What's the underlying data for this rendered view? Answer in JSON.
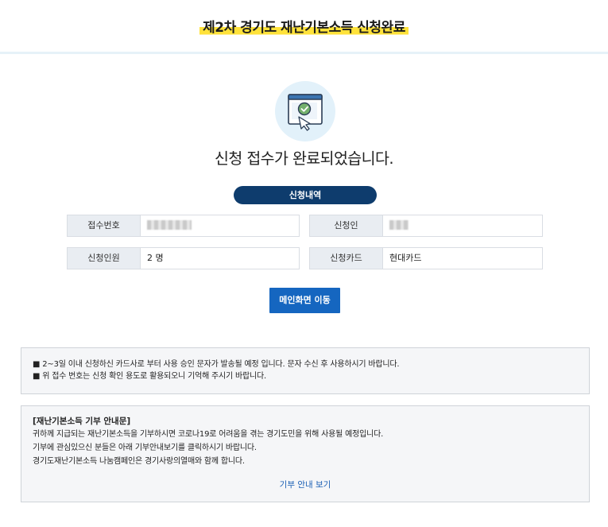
{
  "header": {
    "title": "제2차 경기도 재난기본소득 신청완료"
  },
  "status": {
    "message": "신청 접수가 완료되었습니다."
  },
  "section": {
    "title": "신청내역"
  },
  "details": {
    "receipt_label": "접수번호",
    "applicant_label": "신청인",
    "members_label": "신청인원",
    "members_value": "2 명",
    "card_label": "신청카드",
    "card_value": "현대카드"
  },
  "buttons": {
    "main": "메인화면 이동"
  },
  "notice": {
    "line1": "■ 2~3일 이내 신청하신 카드사로 부터 사용 승인 문자가 발송될 예정 입니다. 문자 수신 후 사용하시기 바랍니다.",
    "line2": "■ 위 접수 번호는 신청 확인 용도로 활용되오니 기억해 주시기 바랍니다."
  },
  "donation": {
    "title": "[재난기본소득 기부 안내문]",
    "line1": "귀하께 지급되는 재난기본소득을 기부하시면 코로나19로 어려움을 겪는 경기도민을 위해 사용될 예정입니다.",
    "line2": "기부에 관심있으신 분들은 아래 기부안내보기를 클릭하시기 바랍니다.",
    "line3": "경기도재난기본소득 나눔캠페인은 경기사랑의열매와 함께 합니다.",
    "link": "기부 안내 보기"
  },
  "icons": {
    "hero": "browser-check-icon"
  },
  "colors": {
    "accent": "#1566c0",
    "navy": "#0e3c6d",
    "highlight": "#ffe23a"
  }
}
